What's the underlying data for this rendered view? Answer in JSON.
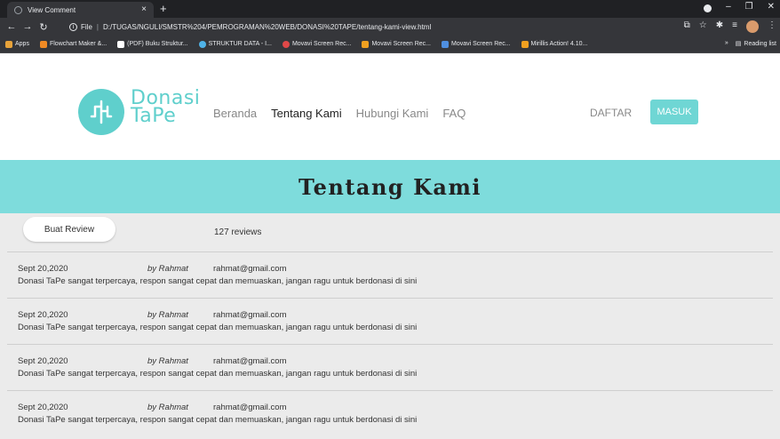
{
  "browser": {
    "tab_title": "View Comment",
    "tab_close": "×",
    "new_tab": "+",
    "url_prefix": "File",
    "url": "D:/TUGAS/NGULI/SMSTR%204/PEMROGRAMAN%20WEB/DONASI%20TAPE/tentang-kami-view.html",
    "bookmarks": [
      {
        "label": "Apps",
        "color": "#e8a33a"
      },
      {
        "label": "Flowchart Maker &...",
        "color": "#f08a24"
      },
      {
        "label": "(PDF) Buku Struktur...",
        "color": "#ffffff"
      },
      {
        "label": "STRUKTUR DATA - I...",
        "color": "#4fb3e8"
      },
      {
        "label": "Movavi Screen Rec...",
        "color": "#e04848"
      },
      {
        "label": "Movavi Screen Rec...",
        "color": "#f0a020"
      },
      {
        "label": "Movavi Screen Rec...",
        "color": "#4f8fe0"
      },
      {
        "label": "Mirillis Action! 4.10...",
        "color": "#f0a020"
      }
    ],
    "bookmarks_more": "»",
    "reading_list": "Reading list"
  },
  "site": {
    "logo_line1": "Donasi",
    "logo_line2": "TaPe",
    "nav": [
      "Beranda",
      "Tentang Kami",
      "Hubungi Kami",
      "FAQ"
    ],
    "active_nav": "Tentang Kami",
    "daftar": "DAFTAR",
    "masuk": "MASUK",
    "accent_color": "#7edcdc"
  },
  "hero": {
    "title": "Tentang Kami"
  },
  "reviews": {
    "button_label": "Buat Review",
    "count": "127 reviews",
    "items": [
      {
        "date": "Sept 20,2020",
        "by": "by Rahmat",
        "email": "rahmat@gmail.com",
        "text": "Donasi TaPe sangat terpercaya, respon sangat cepat dan memuaskan, jangan ragu untuk berdonasi di sini"
      },
      {
        "date": "Sept 20,2020",
        "by": "by Rahmat",
        "email": "rahmat@gmail.com",
        "text": "Donasi TaPe sangat terpercaya, respon sangat cepat dan memuaskan, jangan ragu untuk berdonasi di sini"
      },
      {
        "date": "Sept 20,2020",
        "by": "by Rahmat",
        "email": "rahmat@gmail.com",
        "text": "Donasi TaPe sangat terpercaya, respon sangat cepat dan memuaskan, jangan ragu untuk berdonasi di sini"
      },
      {
        "date": "Sept 20,2020",
        "by": "by Rahmat",
        "email": "rahmat@gmail.com",
        "text": "Donasi TaPe sangat terpercaya, respon sangat cepat dan memuaskan, jangan ragu untuk berdonasi di sini"
      }
    ]
  }
}
